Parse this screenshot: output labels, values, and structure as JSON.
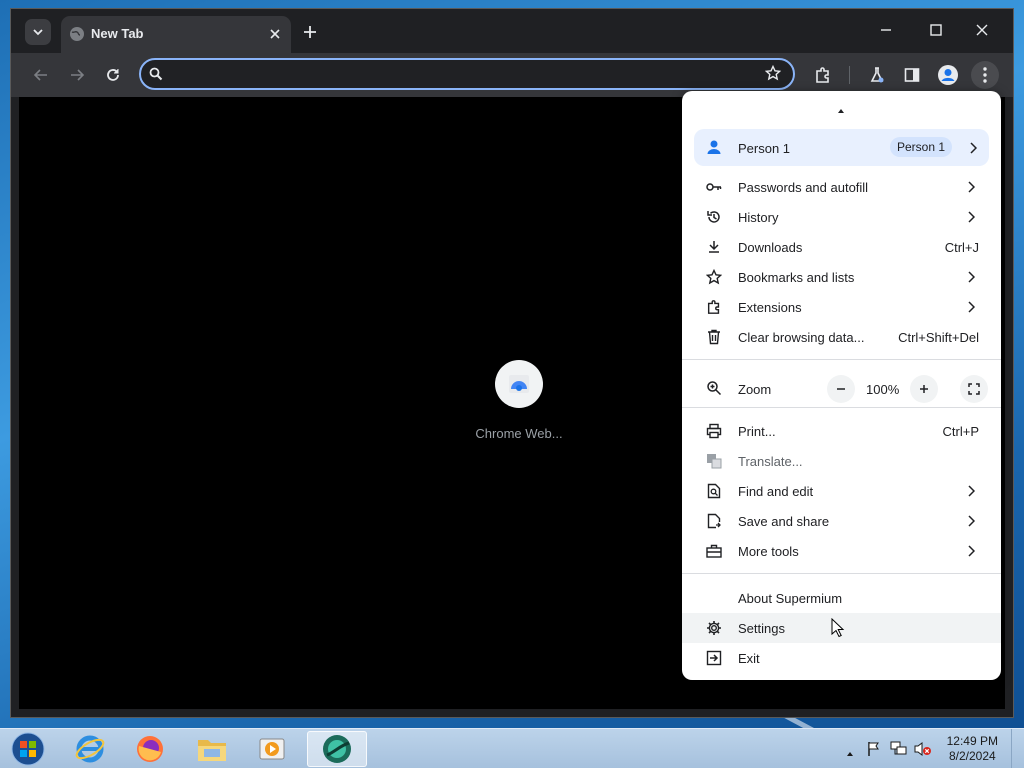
{
  "tab": {
    "title": "New Tab"
  },
  "omnibox": {
    "value": ""
  },
  "shortcut": {
    "label": "Chrome Web..."
  },
  "menu": {
    "profile": {
      "name": "Person 1",
      "badge": "Person 1"
    },
    "items1": [
      {
        "label": "Passwords and autofill",
        "icon": "key-icon",
        "shortcut": "",
        "submenu": true
      },
      {
        "label": "History",
        "icon": "history-icon",
        "shortcut": "",
        "submenu": true
      },
      {
        "label": "Downloads",
        "icon": "download-icon",
        "shortcut": "Ctrl+J",
        "submenu": false
      },
      {
        "label": "Bookmarks and lists",
        "icon": "star-icon",
        "shortcut": "",
        "submenu": true
      },
      {
        "label": "Extensions",
        "icon": "puzzle-icon",
        "shortcut": "",
        "submenu": true
      },
      {
        "label": "Clear browsing data...",
        "icon": "trash-icon",
        "shortcut": "Ctrl+Shift+Del",
        "submenu": false
      }
    ],
    "zoom": {
      "label": "Zoom",
      "value": "100%"
    },
    "items2": [
      {
        "label": "Print...",
        "icon": "print-icon",
        "shortcut": "Ctrl+P",
        "submenu": false
      },
      {
        "label": "Translate...",
        "icon": "translate-icon",
        "shortcut": "",
        "submenu": false
      },
      {
        "label": "Find and edit",
        "icon": "find-icon",
        "shortcut": "",
        "submenu": true
      },
      {
        "label": "Save and share",
        "icon": "save-icon",
        "shortcut": "",
        "submenu": true
      },
      {
        "label": "More tools",
        "icon": "toolbox-icon",
        "shortcut": "",
        "submenu": true
      }
    ],
    "items3": [
      {
        "label": "About Supermium",
        "icon": "",
        "shortcut": ""
      },
      {
        "label": "Settings",
        "icon": "gear-icon",
        "shortcut": ""
      },
      {
        "label": "Exit",
        "icon": "exit-icon",
        "shortcut": ""
      }
    ]
  },
  "taskbar": {
    "time": "12:49 PM",
    "date": "8/2/2024"
  },
  "colors": {
    "accent": "#8ab4f8",
    "menu_bg": "#ffffff",
    "toolbar_bg": "#35363a",
    "frame_bg": "#1f2023"
  }
}
